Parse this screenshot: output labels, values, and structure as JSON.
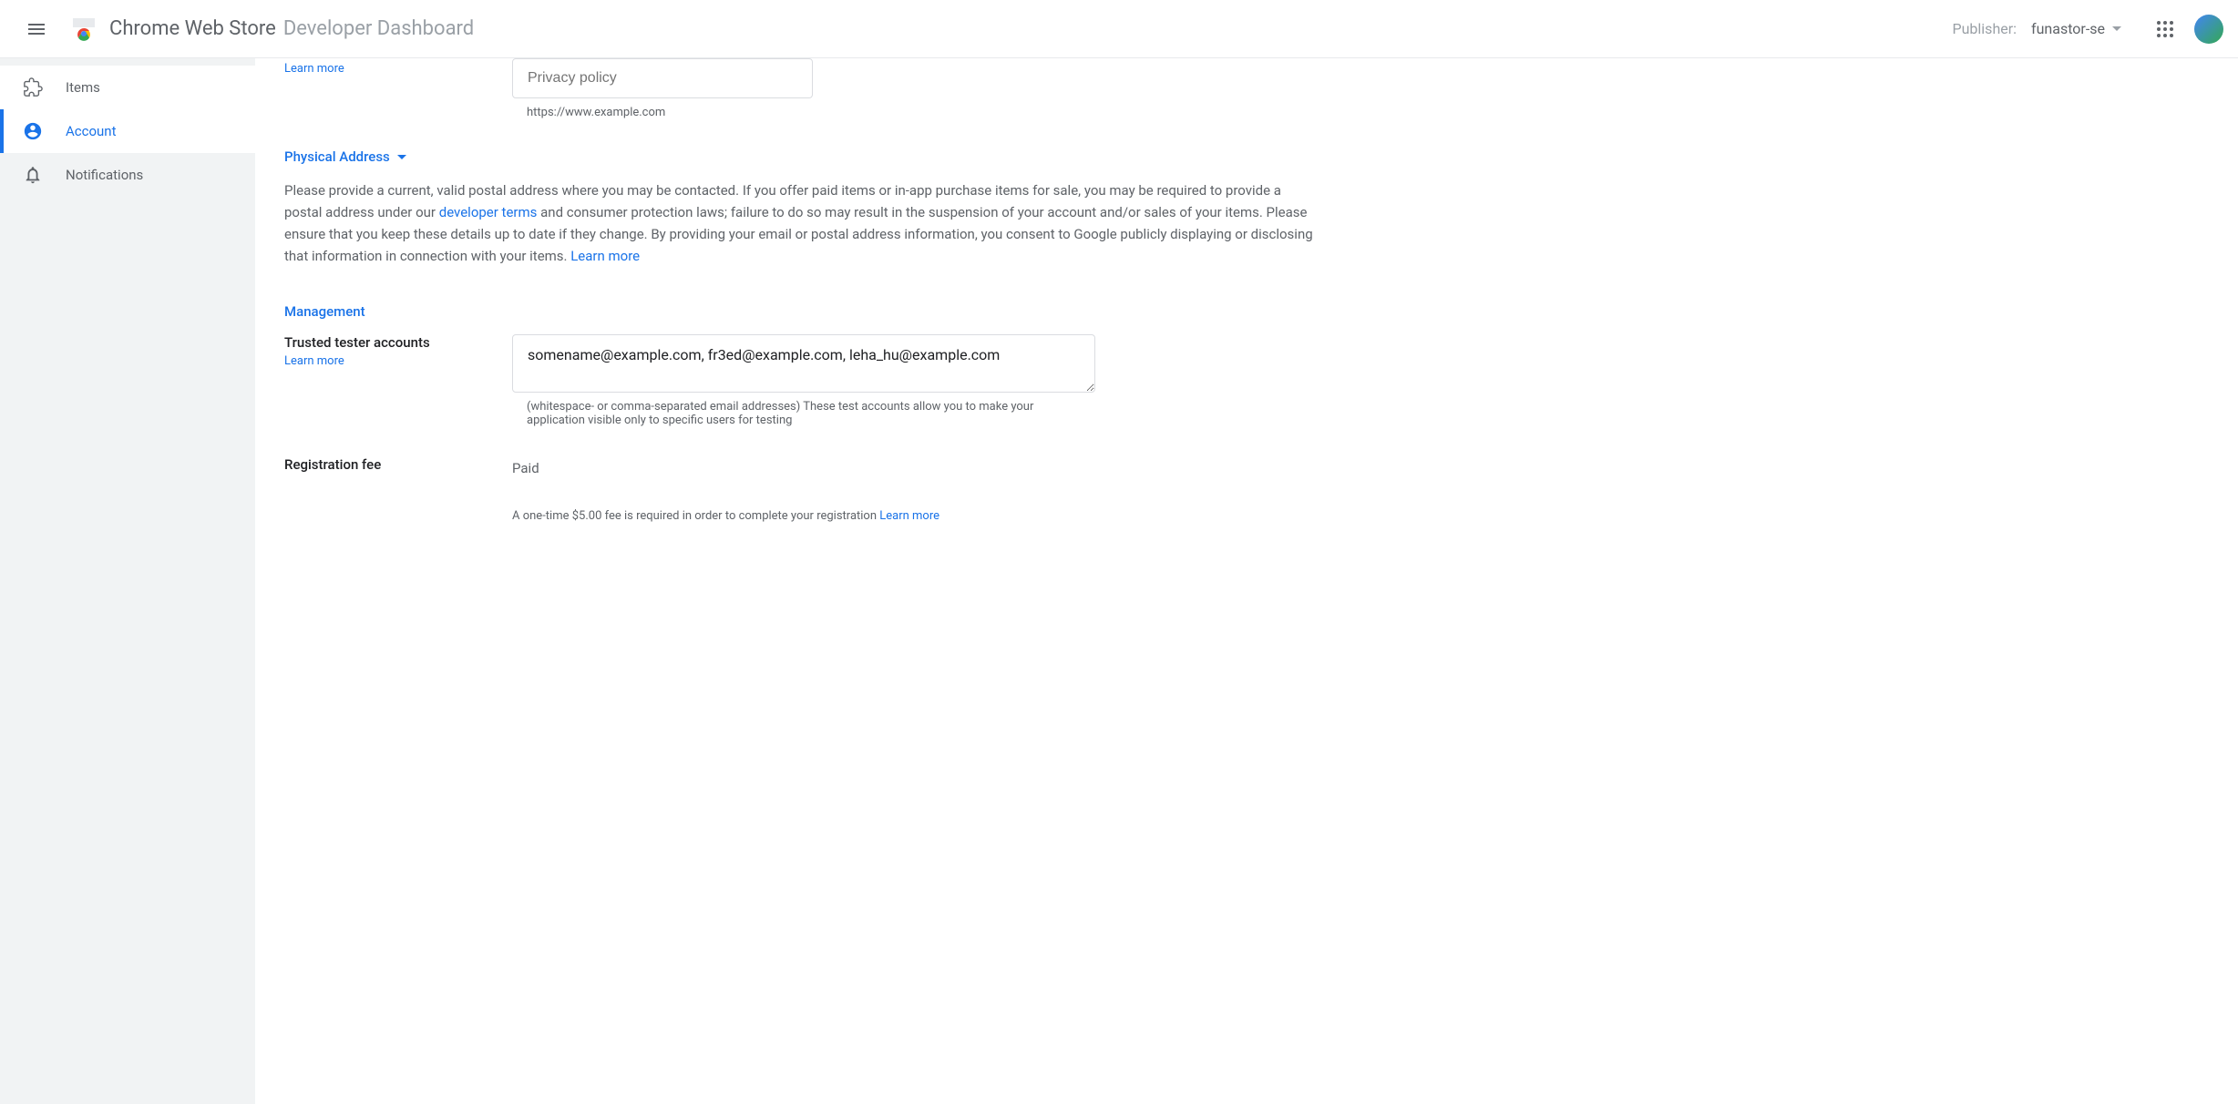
{
  "header": {
    "title_bold": "Chrome Web Store",
    "title_light": "Developer Dashboard",
    "publisher_label": "Publisher:",
    "publisher_value": "funastor-se"
  },
  "sidebar": {
    "items": [
      {
        "label": "Items"
      },
      {
        "label": "Account"
      },
      {
        "label": "Notifications"
      }
    ]
  },
  "privacy": {
    "learn_more": "Learn more",
    "placeholder": "Privacy policy",
    "helper": "https://www.example.com"
  },
  "physical_address": {
    "header": "Physical Address",
    "desc_part1": "Please provide a current, valid postal address where you may be contacted. If you offer paid items or in-app purchase items for sale, you may be required to provide a postal address under our ",
    "dev_terms": "developer terms",
    "desc_part2": " and consumer protection laws; failure to do so may result in the suspension of your account and/or sales of your items. Please ensure that you keep these details up to date if they change. By providing your email or postal address information, you consent to Google publicly displaying or disclosing that information in connection with your items. ",
    "learn_more": "Learn more"
  },
  "management": {
    "header": "Management"
  },
  "trusted_testers": {
    "label": "Trusted tester accounts",
    "learn_more": "Learn more",
    "value": "somename@example.com, fr3ed@example.com, leha_hu@example.com",
    "helper": "(whitespace- or comma-separated email addresses) These test accounts allow you to make your application visible only to specific users for testing"
  },
  "registration_fee": {
    "label": "Registration fee",
    "value": "Paid",
    "helper": "A one-time $5.00 fee is required in order to complete your registration ",
    "learn_more": "Learn more"
  }
}
